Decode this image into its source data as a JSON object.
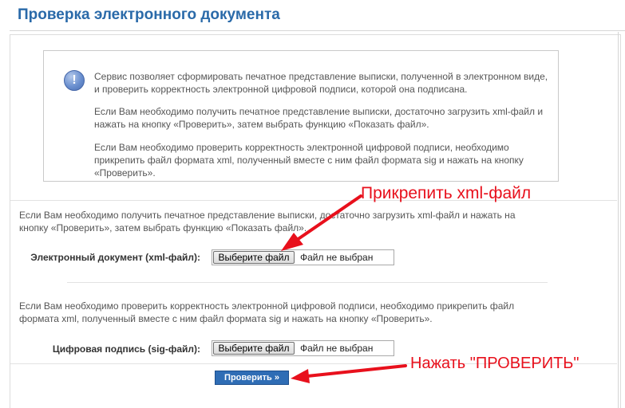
{
  "page": {
    "title": "Проверка электронного документа"
  },
  "info": {
    "paragraphs": [
      "Сервис позволяет сформировать печатное представление выписки, полученной в электронном виде, и проверить корректность электронной цифровой подписи, которой она подписана.",
      "Если Вам необходимо получить печатное представление выписки, достаточно загрузить xml-файл и нажать на кнопку «Проверить», затем выбрать функцию «Показать файл».",
      "Если Вам необходимо проверить корректность электронной цифровой подписи, необходимо прикрепить файл формата xml, полученный вместе с ним файл формата sig и нажать на кнопку «Проверить»."
    ],
    "icon": "info-exclamation-icon"
  },
  "xml_section": {
    "text": "Если Вам необходимо получить печатное представление выписки, достаточно загрузить xml-файл и нажать на кнопку «Проверить», затем выбрать функцию «Показать файл».",
    "label": "Электронный документ (xml-файл):",
    "button": "Выберите файл",
    "status": "Файл не выбран"
  },
  "sig_section": {
    "text": "Если Вам необходимо проверить корректность электронной цифровой подписи, необходимо прикрепить файл формата xml, полученный вместе с ним файл формата sig и нажать на кнопку «Проверить».",
    "label": "Цифровая подпись (sig-файл):",
    "button": "Выберите файл",
    "status": "Файл не выбран"
  },
  "submit": {
    "label": "Проверить »"
  },
  "annotations": {
    "attach_xml": "Прикрепить xml-файл",
    "press_check": "Нажать \"ПРОВЕРИТЬ\"",
    "color": "#e8101c"
  },
  "colors": {
    "title": "#2a6aa9",
    "submit_bg": "#2f6db5"
  }
}
